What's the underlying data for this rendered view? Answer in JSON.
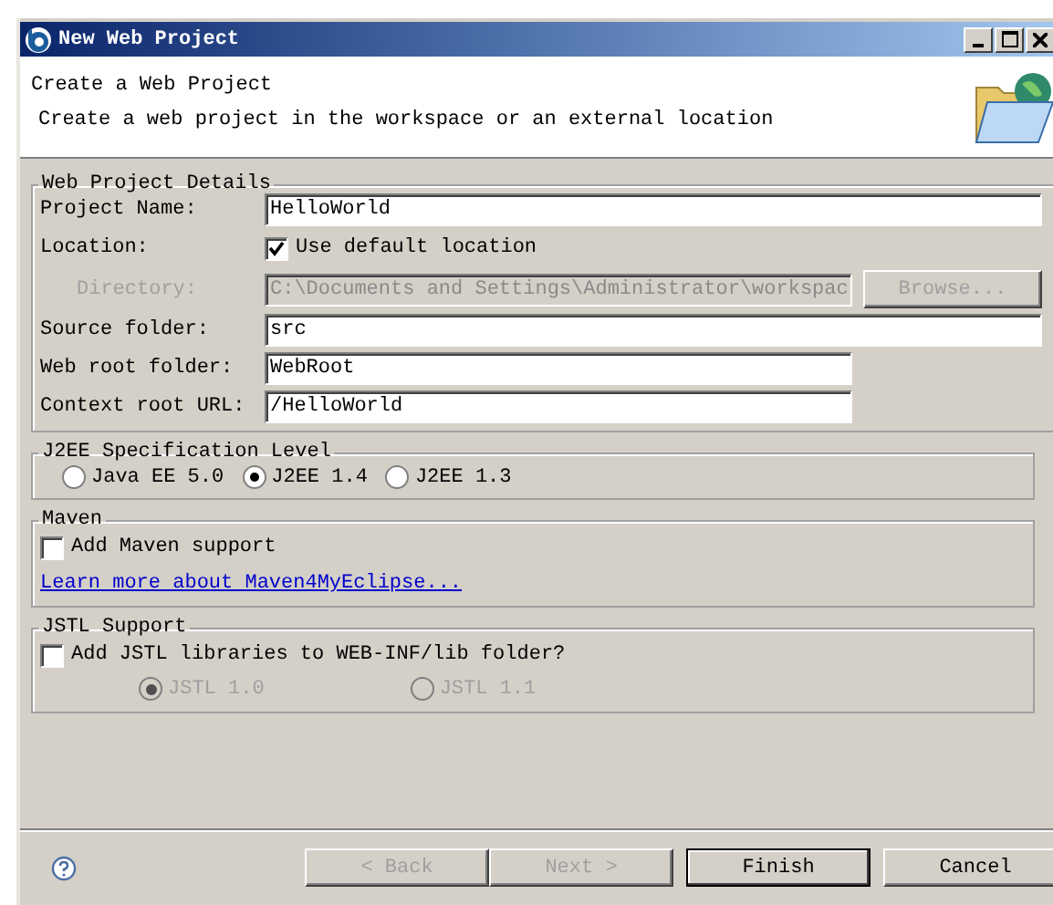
{
  "window": {
    "title": "New Web Project"
  },
  "header": {
    "title": "Create a Web Project",
    "description": "Create a web project in the workspace or an external location"
  },
  "details": {
    "legend": "Web Project Details",
    "rows": [
      {
        "kind": "wide_text",
        "label": "Project Name:",
        "value": "HelloWorld"
      },
      {
        "kind": "checkbox",
        "label": "Location:",
        "text": "Use default location",
        "checked": true
      },
      {
        "kind": "path",
        "label": "Directory:",
        "value": "C:\\Documents and Settings\\Administrator\\workspac",
        "button": "Browse...",
        "disabled": true
      },
      {
        "kind": "wide_text",
        "label": "Source folder:",
        "value": "src"
      },
      {
        "kind": "text",
        "label": "Web root folder:",
        "value": "WebRoot"
      },
      {
        "kind": "text",
        "label": "Context root URL:",
        "value": "/HelloWorld"
      }
    ]
  },
  "j2ee": {
    "legend": "J2EE Specification Level",
    "options": [
      {
        "label": "Java EE 5.0",
        "selected": false
      },
      {
        "label": "J2EE 1.4",
        "selected": true
      },
      {
        "label": "J2EE 1.3",
        "selected": false
      }
    ]
  },
  "maven": {
    "legend": "Maven",
    "checkbox": {
      "label": "Add Maven support",
      "checked": false
    },
    "link": "Learn more about Maven4MyEclipse..."
  },
  "jstl": {
    "legend": "JSTL Support",
    "checkbox": {
      "label": "Add JSTL libraries to WEB-INF/lib folder?",
      "checked": false
    },
    "disabled": true,
    "options": [
      {
        "label": "JSTL 1.0",
        "selected": true
      },
      {
        "label": "JSTL 1.1",
        "selected": false
      }
    ]
  },
  "footer": {
    "buttons": [
      {
        "label": "< Back",
        "disabled": true,
        "default": false
      },
      {
        "label": "Next >",
        "disabled": true,
        "default": false
      },
      {
        "label": "Finish",
        "disabled": false,
        "default": true
      },
      {
        "label": "Cancel",
        "disabled": false,
        "default": false
      }
    ]
  }
}
